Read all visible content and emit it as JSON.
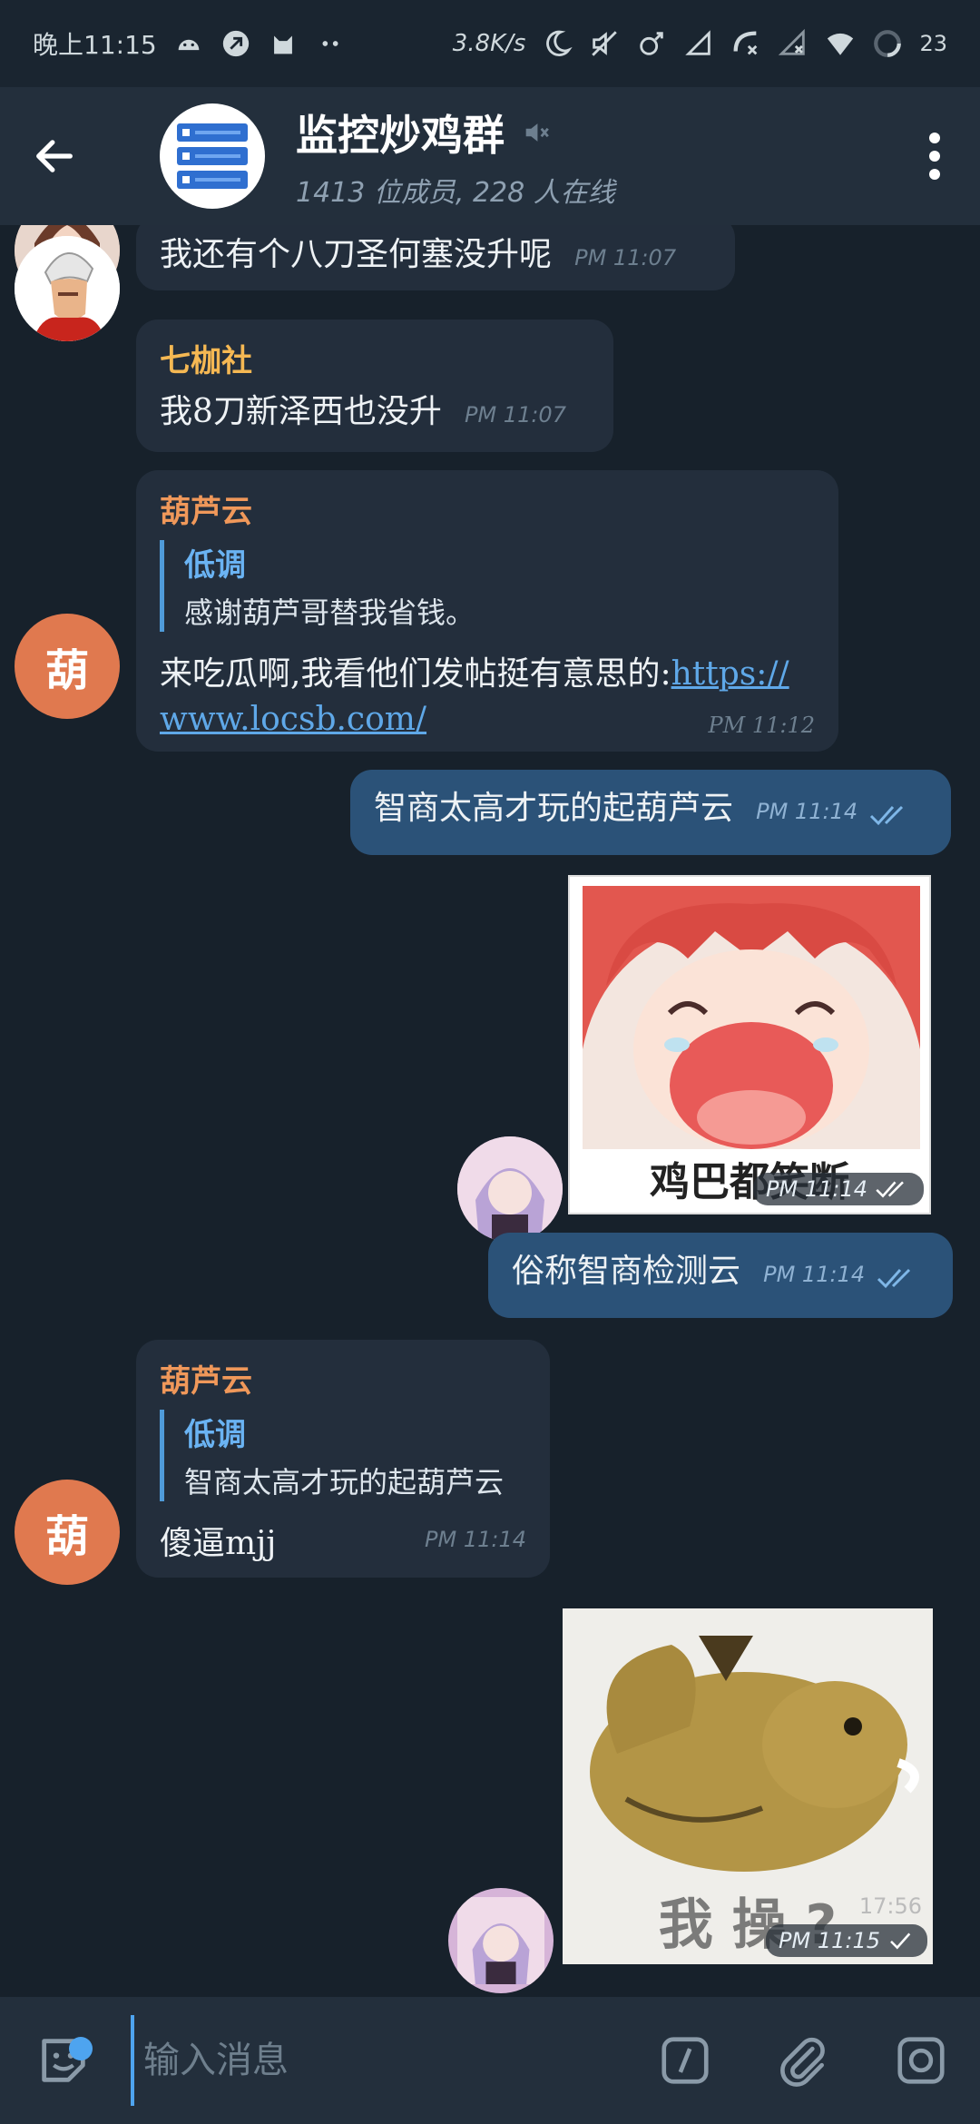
{
  "status_bar": {
    "time": "晚上11:15",
    "net_speed": "3.8K/s",
    "battery": "23"
  },
  "header": {
    "title": "监控炒鸡群",
    "subtitle": "1413 位成员, 228 人在线"
  },
  "messages": [
    {
      "text": "我还有个八刀圣何塞没升呢",
      "time": "PM 11:07"
    },
    {
      "sender": "七枷社",
      "text": "我8刀新泽西也没升",
      "time": "PM 11:07"
    },
    {
      "sender": "葫芦云",
      "avatar_letter": "葫",
      "reply_name": "低调",
      "reply_text": "感谢葫芦哥替我省钱。",
      "text": "来吃瓜啊,我看他们发帖挺有意思的:",
      "link": "https://www.locsb.com/",
      "time": "PM 11:12"
    },
    {
      "text": "智商太高才玩的起葫芦云",
      "time": "PM 11:14"
    },
    {
      "sticker_caption": "鸡巴都笑断",
      "time": "PM 11:14"
    },
    {
      "text": "俗称智商检测云",
      "time": "PM 11:14"
    },
    {
      "sender": "葫芦云",
      "avatar_letter": "葫",
      "reply_name": "低调",
      "reply_text": "智商太高才玩的起葫芦云",
      "text": "傻逼mjj",
      "time": "PM 11:14"
    },
    {
      "sticker_caption": "我 操 ?",
      "sticker_watermark": "17:56",
      "time": "PM 11:15"
    }
  ],
  "input": {
    "placeholder": "输入消息"
  },
  "colors": {
    "background": "#17212b",
    "incoming_bubble": "#232e3c",
    "outgoing_bubble": "#2b5278",
    "accent": "#4ea4ef",
    "sender_orange": "#f0985a",
    "sender_yellow": "#f5b853"
  }
}
